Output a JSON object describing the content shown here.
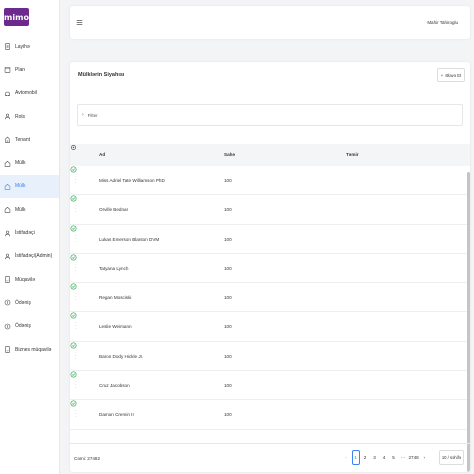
{
  "app": {
    "logo_text": "mimo",
    "brand_color": "#6b2a8c",
    "accent_color": "#3b82f6"
  },
  "sidebar": {
    "items": [
      {
        "label": "Layihə",
        "icon": "document-icon"
      },
      {
        "label": "Plan",
        "icon": "calendar-icon"
      },
      {
        "label": "Avtomobil",
        "icon": "car-icon"
      },
      {
        "label": "Rols",
        "icon": "user-icon"
      },
      {
        "label": "Tenant",
        "icon": "building-icon"
      },
      {
        "label": "Mülk",
        "icon": "home-icon"
      },
      {
        "label": "Mülk",
        "icon": "home-icon",
        "active": true
      },
      {
        "label": "Mülk",
        "icon": "home-icon"
      },
      {
        "label": "İstifadəçi",
        "icon": "user-icon"
      },
      {
        "label": "İstifadəçi(Admin)",
        "icon": "user-icon"
      },
      {
        "label": "Müqavilə",
        "icon": "contract-icon"
      },
      {
        "label": "Ödəniş",
        "icon": "payment-icon"
      },
      {
        "label": "Ödəniş",
        "icon": "payment-icon"
      },
      {
        "label": "Biznes müqavilə",
        "icon": "contract-icon"
      }
    ]
  },
  "header": {
    "user_name": "Mahir Tahiroglu"
  },
  "card": {
    "title": "Mülklərin Siyahısı",
    "add_label": "Əlavə Et",
    "filter_label": "Filter"
  },
  "table": {
    "columns": [
      "Ad",
      "Sahə",
      "Təmir"
    ],
    "rows": [
      {
        "name": "Miss Adriel Tate Williamson PhD",
        "area": "100"
      },
      {
        "name": "Orville Bednar",
        "area": "100"
      },
      {
        "name": "Lukas Emerson Blanton DVM",
        "area": "100"
      },
      {
        "name": "Tatyana Lynch",
        "area": "100"
      },
      {
        "name": "Regan Mosciski",
        "area": "100"
      },
      {
        "name": "Leslie Weimann",
        "area": "100"
      },
      {
        "name": "Baron Dody Hickle Jr.",
        "area": "100"
      },
      {
        "name": "Cruz Jacobson",
        "area": "100"
      },
      {
        "name": "Damon Cremin II",
        "area": "100"
      }
    ]
  },
  "footer": {
    "total": "Cəmi: 27482",
    "pages": [
      "‹",
      "1",
      "2",
      "3",
      "4",
      "5",
      "···",
      "2748",
      "›"
    ],
    "page_size": "10 / səhifə"
  }
}
